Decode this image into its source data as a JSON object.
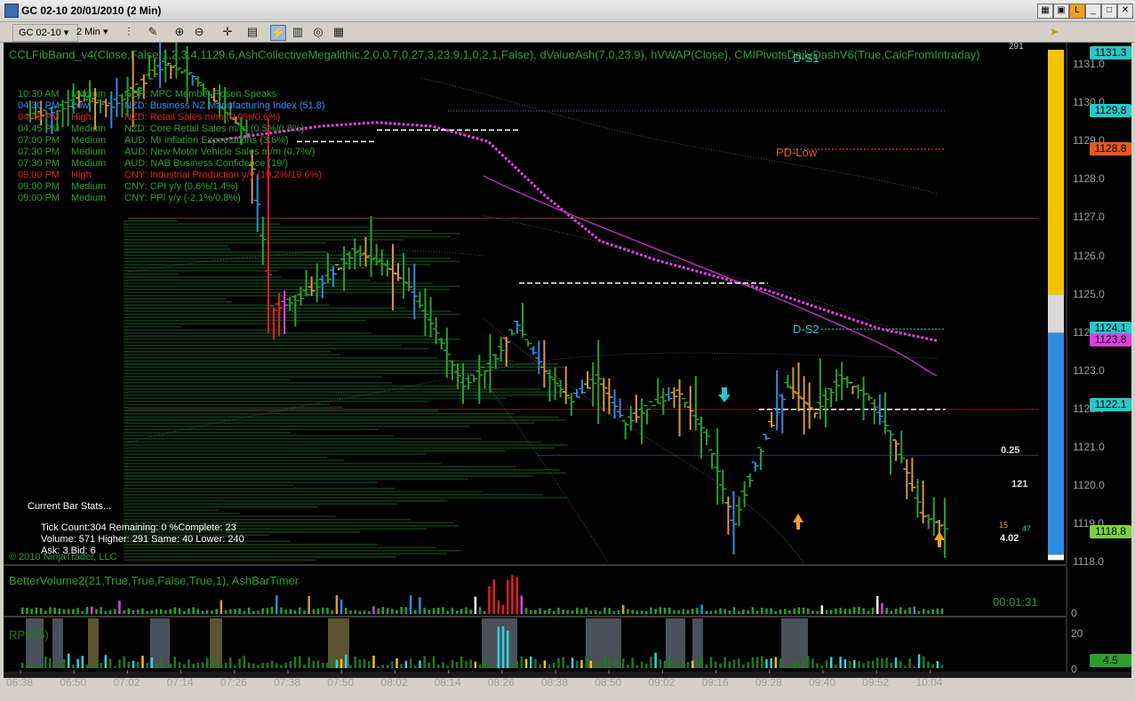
{
  "window": {
    "title": "GC 02-10  20/01/2010 (2 Min)"
  },
  "toolbar": {
    "instrument": "GC 02-10",
    "interval": "2 Min"
  },
  "indicators": {
    "main": "CCLFibBand_v4(Close,False,1,2,3,4,1129.6,AshCollectiveMegalithic,2,0,0.7,0,27,3,23.9,1,0,2,1,False), dValueAsh(7,0,23.9), hVWAP(Close), CMIPivotsDailyDashV6(True,CalcFromIntraday)",
    "volume": "BetterVolume2(21,True,True,False,True,1), AshBarTimer",
    "rpm": "RPM(6)"
  },
  "news": [
    {
      "time": "10:30 AM",
      "impact": "Medium",
      "text": "GBP: MPC Member Posen Speaks",
      "color": "#2ca02c"
    },
    {
      "time": "04:30 PM",
      "impact": "Low",
      "text": "NZD: Business NZ Manufacturing Index (51.8)",
      "color": "#3b8bff"
    },
    {
      "time": "04:45 PM",
      "impact": "High",
      "text": "NZD: Retail Sales m/m (0.0%/0.6%)",
      "color": "#e02020"
    },
    {
      "time": "04:45 PM",
      "impact": "Medium",
      "text": "NZD: Core Retail Sales m/m (0.5%/0.8%)",
      "color": "#2ca02c"
    },
    {
      "time": "07:00 PM",
      "impact": "Medium",
      "text": "AUD: MI Inflation Expectations (3.6%)",
      "color": "#2ca02c"
    },
    {
      "time": "07:30 PM",
      "impact": "Medium",
      "text": "AUD: New Motor Vehicle Sales m/m (0.7%/)",
      "color": "#2ca02c"
    },
    {
      "time": "07:30 PM",
      "impact": "Medium",
      "text": "AUD: NAB Business Confidence (19/)",
      "color": "#2ca02c"
    },
    {
      "time": "09:00 PM",
      "impact": "High",
      "text": "CNY: Industrial Production y/y (19.2%/19.6%)",
      "color": "#e02020"
    },
    {
      "time": "09:00 PM",
      "impact": "Medium",
      "text": "CNY: CPI y/y (0.6%/1.4%)",
      "color": "#2ca02c"
    },
    {
      "time": "09:00 PM",
      "impact": "Medium",
      "text": "CNY: PPI y/y (-2.1%/0.8%)",
      "color": "#2ca02c"
    }
  ],
  "stats": {
    "header": "Current Bar Stats...",
    "line1": "Tick Count:304  Remaining: 0  %Complete: 23",
    "line2": "Volume: 571  Higher: 291  Same: 40  Lower: 240",
    "line3": "Ask: 3  Bid: 6"
  },
  "copyright": "© 2010 NinjaTrader, LLC",
  "pivots": {
    "ds1": "D-S1",
    "pdlow": "PD-Low",
    "ds2": "D-S2"
  },
  "timer": "00:01:31",
  "misc_labels": {
    "top": "291",
    "tick": "0.25",
    "vol": "121",
    "small1": "15",
    "small2": "47",
    "delta": "4.02"
  },
  "price_labels": [
    {
      "text": "1131.3",
      "y": 1131.3,
      "color": "#29c7c7"
    },
    {
      "text": "1129.8",
      "y": 1129.8,
      "color": "#29c7c7"
    },
    {
      "text": "1128.8",
      "y": 1128.8,
      "color": "#e85a1a"
    },
    {
      "text": "1124.1",
      "y": 1124.1,
      "color": "#29c7c7"
    },
    {
      "text": "1123.8",
      "y": 1123.8,
      "color": "#e040e0"
    },
    {
      "text": "1122.1",
      "y": 1122.1,
      "color": "#29c7c7"
    },
    {
      "text": "1118.8",
      "y": 1118.8,
      "color": "#7cd13b"
    }
  ],
  "volume_labels": {
    "zero": "0"
  },
  "rpm_labels": {
    "top": "20",
    "zero": "0",
    "current": "4.5"
  },
  "chart_data": {
    "type": "line",
    "instrument": "GC 02-10",
    "y_ticks": [
      1118.0,
      1119.0,
      1120.0,
      1121.0,
      1122.0,
      1123.0,
      1124.0,
      1125.0,
      1126.0,
      1127.0,
      1128.0,
      1129.0,
      1130.0,
      1131.0
    ],
    "ylim": [
      1118.0,
      1131.4
    ],
    "x_ticks": [
      "06:38",
      "06:50",
      "07:02",
      "07:14",
      "07:26",
      "07:38",
      "07:50",
      "08:02",
      "08:14",
      "08:26",
      "08:38",
      "08:50",
      "09:02",
      "09:16",
      "09:28",
      "09:40",
      "09:52",
      "10:04"
    ],
    "price_path": [
      1129.6,
      1129.8,
      1130.1,
      1129.9,
      1130.4,
      1131.0,
      1130.7,
      1129.9,
      1129.2,
      1124.6,
      1124.9,
      1125.4,
      1126.1,
      1125.8,
      1125.2,
      1124.0,
      1122.6,
      1123.1,
      1124.2,
      1123.0,
      1122.2,
      1122.8,
      1121.6,
      1122.1,
      1122.4,
      1121.3,
      1119.0,
      1120.9,
      1122.6,
      1121.9,
      1122.8,
      1122.3,
      1121.1,
      1119.2,
      1118.8
    ],
    "vwap": [
      1129.0,
      1129.2,
      1129.4,
      1129.5,
      1129.4,
      1129.0,
      1127.6,
      1126.4,
      1125.9,
      1125.5,
      1125.1,
      1124.6,
      1124.1,
      1123.8
    ]
  }
}
